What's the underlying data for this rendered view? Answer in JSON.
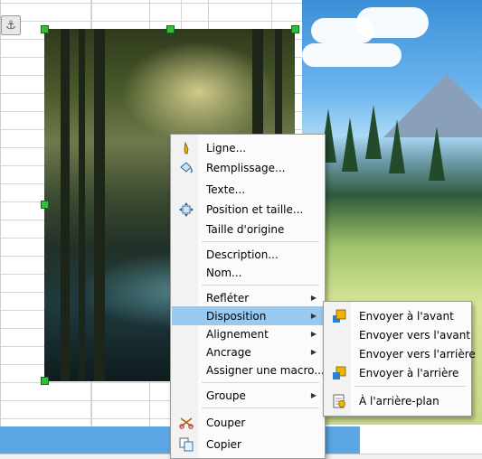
{
  "context_menu": {
    "items": [
      {
        "label": "Ligne...",
        "icon": "pen-icon"
      },
      {
        "label": "Remplissage...",
        "icon": "paint-bucket-icon"
      },
      {
        "label": "Texte...",
        "icon": ""
      },
      {
        "label": "Position et taille...",
        "icon": "move-resize-icon"
      },
      {
        "label": "Taille d'origine",
        "icon": ""
      },
      {
        "label": "Description...",
        "icon": ""
      },
      {
        "label": "Nom...",
        "icon": ""
      },
      {
        "label": "Refléter",
        "icon": "",
        "submenu": true
      },
      {
        "label": "Disposition",
        "icon": "",
        "submenu": true,
        "highlighted": true
      },
      {
        "label": "Alignement",
        "icon": "",
        "submenu": true
      },
      {
        "label": "Ancrage",
        "icon": "",
        "submenu": true
      },
      {
        "label": "Assigner une macro...",
        "icon": ""
      },
      {
        "label": "Groupe",
        "icon": "",
        "submenu": true
      },
      {
        "label": "Couper",
        "icon": "scissors-icon"
      },
      {
        "label": "Copier",
        "icon": "copy-icon"
      }
    ]
  },
  "submenu": {
    "items": [
      {
        "label": "Envoyer à l'avant",
        "icon": "bring-to-front-icon"
      },
      {
        "label": "Envoyer vers l'avant",
        "icon": ""
      },
      {
        "label": "Envoyer vers l'arrière",
        "icon": ""
      },
      {
        "label": "Envoyer à l'arrière",
        "icon": "send-to-back-icon"
      },
      {
        "label": "À l'arrière-plan",
        "icon": "to-background-icon"
      }
    ]
  },
  "colors": {
    "highlight": "#99c9ef",
    "selection_handle": "#2fbf3a",
    "selection_band": "#5ba6e3"
  }
}
